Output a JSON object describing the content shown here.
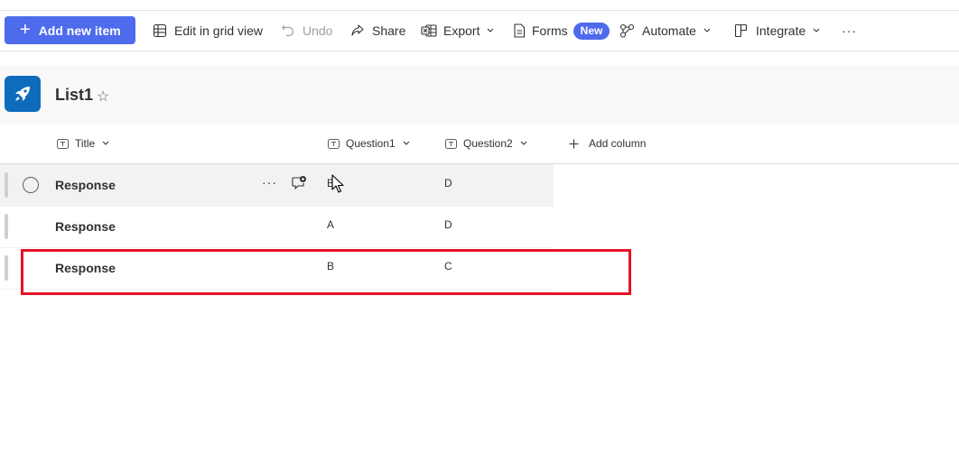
{
  "toolbar": {
    "add_new_item": "Add new item",
    "edit_grid": "Edit in grid view",
    "undo": "Undo",
    "share": "Share",
    "export": "Export",
    "forms": "Forms",
    "forms_badge": "New",
    "automate": "Automate",
    "integrate": "Integrate",
    "more": "···"
  },
  "list": {
    "title": "List1",
    "star": "☆",
    "icon": "rocket-icon",
    "accent_color": "#0f6cbd"
  },
  "columns": [
    {
      "label": "Title"
    },
    {
      "label": "Question1"
    },
    {
      "label": "Question2"
    }
  ],
  "add_column": "Add column",
  "rows": [
    {
      "title": "Response",
      "q1": "B",
      "q2": "D",
      "more": "···"
    },
    {
      "title": "Response",
      "q1": "A",
      "q2": "D"
    },
    {
      "title": "Response",
      "q1": "B",
      "q2": "C"
    }
  ],
  "colors": {
    "primary": "#4f6bed",
    "highlight": "#e81123"
  }
}
